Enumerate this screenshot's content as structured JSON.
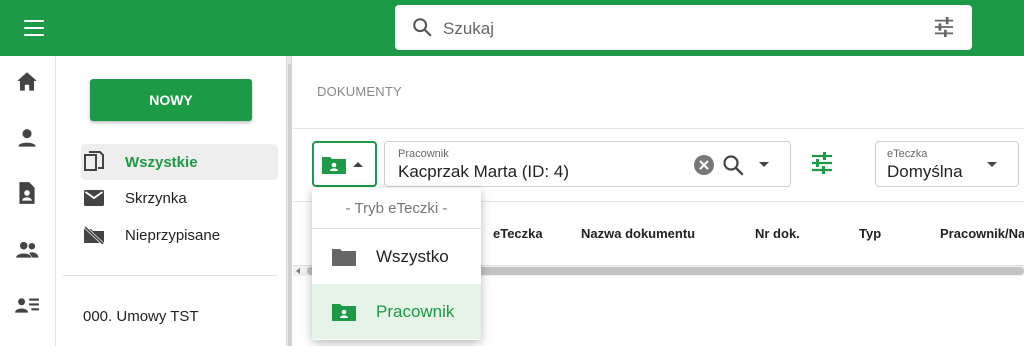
{
  "search": {
    "placeholder": "Szukaj"
  },
  "rail": {
    "items": [
      "home-icon",
      "person-icon",
      "document-person-icon",
      "people-icon",
      "contact-list-icon"
    ]
  },
  "sidebar": {
    "new_button": "NOWY",
    "items": [
      {
        "label": "Wszystkie",
        "icon": "copy-icon",
        "active": true
      },
      {
        "label": "Skrzynka",
        "icon": "mail-icon"
      },
      {
        "label": "Nieprzypisane",
        "icon": "folder-off-icon"
      }
    ],
    "folder": "000. Umowy TST"
  },
  "main": {
    "breadcrumb": "DOKUMENTY",
    "employee": {
      "label": "Pracownik",
      "value": "Kacprzak Marta (ID: 4)"
    },
    "eteczka": {
      "label": "eTeczka",
      "value": "Domyślna"
    },
    "columns": [
      "eTeczka",
      "Nazwa dokumentu",
      "Nr dok.",
      "Typ",
      "Pracownik/Na"
    ]
  },
  "dropdown": {
    "header": "- Tryb eTeczki -",
    "options": [
      {
        "label": "Wszystko",
        "icon": "folder-icon"
      },
      {
        "label": "Pracownik",
        "icon": "folder-person-icon",
        "selected": true
      }
    ]
  },
  "colors": {
    "primary": "#1c9a45",
    "selected_bg": "#e5f3e9"
  }
}
